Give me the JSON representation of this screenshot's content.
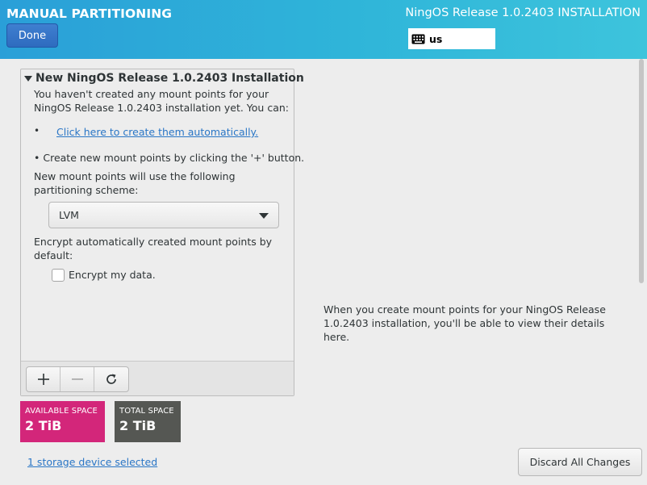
{
  "header": {
    "title": "MANUAL PARTITIONING",
    "release": "NingOS Release 1.0.2403 INSTALLATION",
    "done_label": "Done",
    "keyboard_layout": "us",
    "keyboard_icon": "keyboard-icon"
  },
  "left_panel": {
    "group_title": "New NingOS Release 1.0.2403 Installation",
    "intro_text": "You haven't created any mount points for your NingOS Release 1.0.2403 installation yet.  You can:",
    "bullet": "•",
    "auto_link": "Click here to create them automatically.",
    "create_line": "•  Create new mount points by clicking the '+' button.",
    "scheme_label": "New mount points will use the following partitioning scheme:",
    "scheme_value": "LVM",
    "encrypt_label": "Encrypt automatically created mount points by default:",
    "encrypt_checkbox_label": "Encrypt my data.",
    "encrypt_checked": false,
    "toolbar_icons": [
      "plus-icon",
      "minus-icon",
      "refresh-icon"
    ]
  },
  "space": {
    "available_caption": "AVAILABLE SPACE",
    "available_value": "2 TiB",
    "total_caption": "TOTAL SPACE",
    "total_value": "2 TiB"
  },
  "storage_link": "1 storage device selected",
  "right_info": "When you create mount points for your NingOS Release 1.0.2403 installation, you'll be able to view their details here.",
  "discard_label": "Discard All Changes",
  "colors": {
    "header": "#2fb5d9",
    "done_button": "#3574c8",
    "available": "#d3267a",
    "total": "#555753",
    "link": "#2a76c6"
  }
}
